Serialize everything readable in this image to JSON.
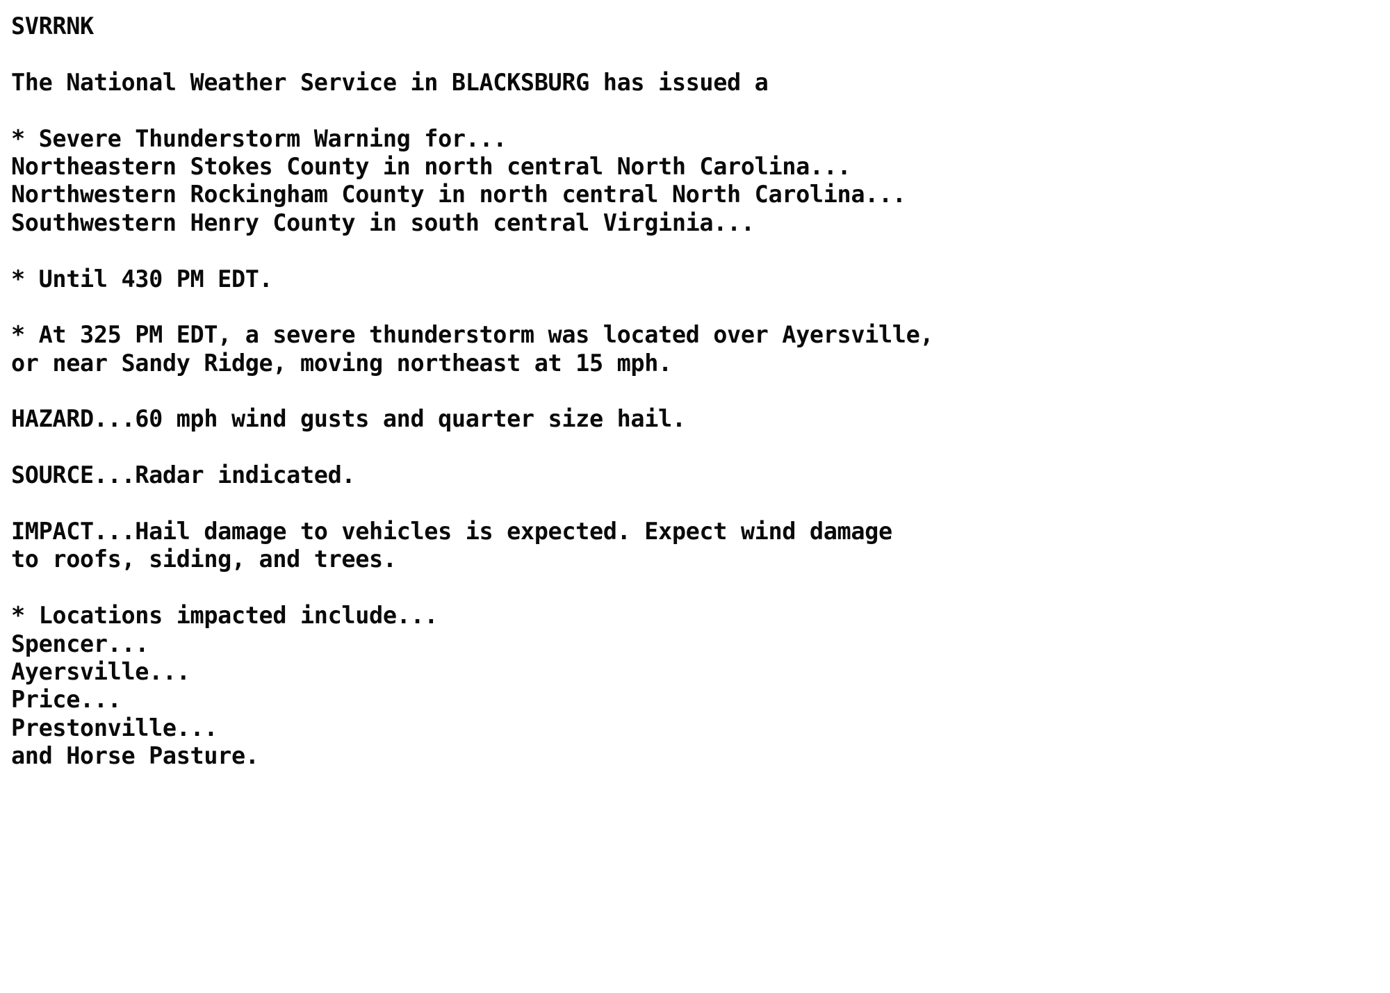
{
  "document": {
    "type": "nws-text-bulletin",
    "product_id": "SVRRNK",
    "background_color": "#ffffff",
    "text_color": "#0a0a0a",
    "issuing_office": "BLACKSBURG",
    "warning_type": "Severe Thunderstorm Warning",
    "expiration": "430 PM EDT",
    "event_time": "325 PM EDT",
    "storm_location": "Ayersville",
    "storm_near": "Sandy Ridge",
    "storm_direction": "northeast",
    "storm_speed": "15 mph",
    "hazard": "60 mph wind gusts and quarter size hail.",
    "source": "Radar indicated.",
    "impact": "Hail damage to vehicles is expected. Expect wind damage to roofs, siding, and trees.",
    "counties": [
      "Northeastern Stokes County in north central North Carolina...",
      "Northwestern Rockingham County in north central North Carolina...",
      "Southwestern Henry County in south central Virginia..."
    ],
    "locations": [
      "Spencer...",
      "Ayersville...",
      "Price...",
      "Prestonville...",
      "and Horse Pasture."
    ],
    "lines": [
      "SVRRNK",
      "",
      "The National Weather Service in BLACKSBURG has issued a",
      "",
      "* Severe Thunderstorm Warning for...",
      "Northeastern Stokes County in north central North Carolina...",
      "Northwestern Rockingham County in north central North Carolina...",
      "Southwestern Henry County in south central Virginia...",
      "",
      "* Until 430 PM EDT.",
      "",
      "* At 325 PM EDT, a severe thunderstorm was located over Ayersville,",
      "or near Sandy Ridge, moving northeast at 15 mph.",
      "",
      "HAZARD...60 mph wind gusts and quarter size hail.",
      "",
      "SOURCE...Radar indicated.",
      "",
      "IMPACT...Hail damage to vehicles is expected. Expect wind damage",
      "to roofs, siding, and trees.",
      "",
      "* Locations impacted include...",
      "Spencer...",
      "Ayersville...",
      "Price...",
      "Prestonville...",
      "and Horse Pasture."
    ]
  }
}
